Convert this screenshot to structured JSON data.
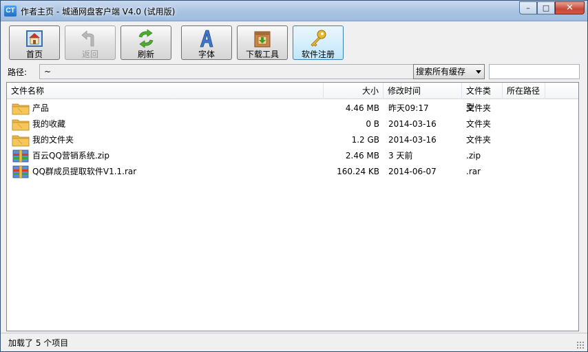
{
  "window": {
    "app_icon_text": "CT",
    "title": "作者主页 - 城通网盘客户端 V4.0 (试用版)",
    "minimize": "–",
    "maximize": "□",
    "close": "✕"
  },
  "toolbar": {
    "home": "首页",
    "back": "返回",
    "refresh": "刷新",
    "font": "字体",
    "download_tool": "下载工具",
    "register": "软件注册"
  },
  "pathbar": {
    "label": "路径:",
    "value": "~",
    "search_scope": "搜索所有缓存",
    "search_value": ""
  },
  "columns": {
    "name": "文件名称",
    "size": "大小",
    "modified": "修改时间",
    "type": "文件类型",
    "location": "所在路径"
  },
  "files": [
    {
      "icon": "folder-icon",
      "name": "产品",
      "size": "4.46 MB",
      "modified": "昨天09:17",
      "type": "文件夹"
    },
    {
      "icon": "folder-icon",
      "name": "我的收藏",
      "size": "0 B",
      "modified": "2014-03-16",
      "type": "文件夹"
    },
    {
      "icon": "folder-icon",
      "name": "我的文件夹",
      "size": "1.2 GB",
      "modified": "2014-03-16",
      "type": "文件夹"
    },
    {
      "icon": "archive-icon",
      "name": "百云QQ营销系统.zip",
      "size": "2.46 MB",
      "modified": "3 天前",
      "type": ".zip"
    },
    {
      "icon": "archive-icon",
      "name": "QQ群成员提取软件V1.1.rar",
      "size": "160.24 KB",
      "modified": "2014-06-07",
      "type": ".rar"
    }
  ],
  "status": {
    "text": "加载了 5 个项目"
  },
  "colors": {
    "title_gradient": "#a9c3e2",
    "active_button": "#d7effc",
    "folder": "#f5c75a",
    "close_button": "#c8473a"
  }
}
